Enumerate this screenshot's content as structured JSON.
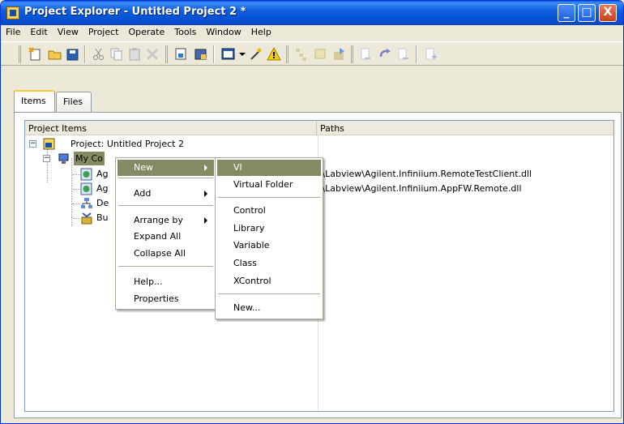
{
  "window": {
    "title": "Project Explorer - Untitled Project 2 *",
    "minimize_glyph": "_",
    "maximize_glyph": "□",
    "close_glyph": "X"
  },
  "menubar": {
    "items": [
      {
        "label": "File",
        "accel": "F"
      },
      {
        "label": "Edit",
        "accel": "E"
      },
      {
        "label": "View",
        "accel": "V"
      },
      {
        "label": "Project",
        "accel": "P"
      },
      {
        "label": "Operate",
        "accel": "O"
      },
      {
        "label": "Tools",
        "accel": "T"
      },
      {
        "label": "Window",
        "accel": "W"
      },
      {
        "label": "Help",
        "accel": "H"
      }
    ]
  },
  "toolbar": {
    "icons": [
      "new-vi-icon",
      "open-icon",
      "save-all-icon",
      "cut-icon",
      "copy-icon",
      "paste-icon",
      "delete-icon",
      "project-properties-icon",
      "build-icon",
      "view-icon",
      "dropdown-icon",
      "wand-icon",
      "warning-icon",
      "tree-collapse-icon",
      "tree-expand-icon",
      "deploy-icon",
      "undo-source-icon",
      "redo-icon",
      "find-icon",
      "add-file-icon"
    ]
  },
  "tabs": [
    {
      "label": "Items",
      "active": true
    },
    {
      "label": "Files",
      "active": false
    }
  ],
  "tree": {
    "headers": {
      "items": "Project Items",
      "paths": "Paths"
    },
    "project_label": "Project: Untitled Project 2",
    "my_computer_label": "My Co",
    "children": [
      {
        "label": "Ag",
        "path": "C:\\Labview\\Agilent.Infiniium.RemoteTestClient.dll"
      },
      {
        "label": "Ag",
        "path": "C:\\Labview\\Agilent.Infiniium.AppFW.Remote.dll"
      },
      {
        "label": "De",
        "path": ""
      },
      {
        "label": "Bu",
        "path": ""
      }
    ]
  },
  "context_menu": {
    "items": [
      {
        "label": "New",
        "submenu": true,
        "highlight": true
      },
      {
        "label": "Add",
        "submenu": true
      },
      {
        "label": "Arrange by",
        "submenu": true
      },
      {
        "label": "Expand All"
      },
      {
        "label": "Collapse All"
      },
      {
        "label": "Help..."
      },
      {
        "label": "Properties"
      }
    ]
  },
  "submenu": {
    "items": [
      {
        "label": "VI",
        "highlight": true
      },
      {
        "label": "Virtual Folder"
      },
      {
        "label": "Control"
      },
      {
        "label": "Library"
      },
      {
        "label": "Variable"
      },
      {
        "label": "Class"
      },
      {
        "label": "XControl"
      },
      {
        "label": "New..."
      }
    ]
  },
  "colors": {
    "titlebar": "#0554d6",
    "menu_highlight": "#858a63",
    "tab_accent": "#ffc83c"
  }
}
